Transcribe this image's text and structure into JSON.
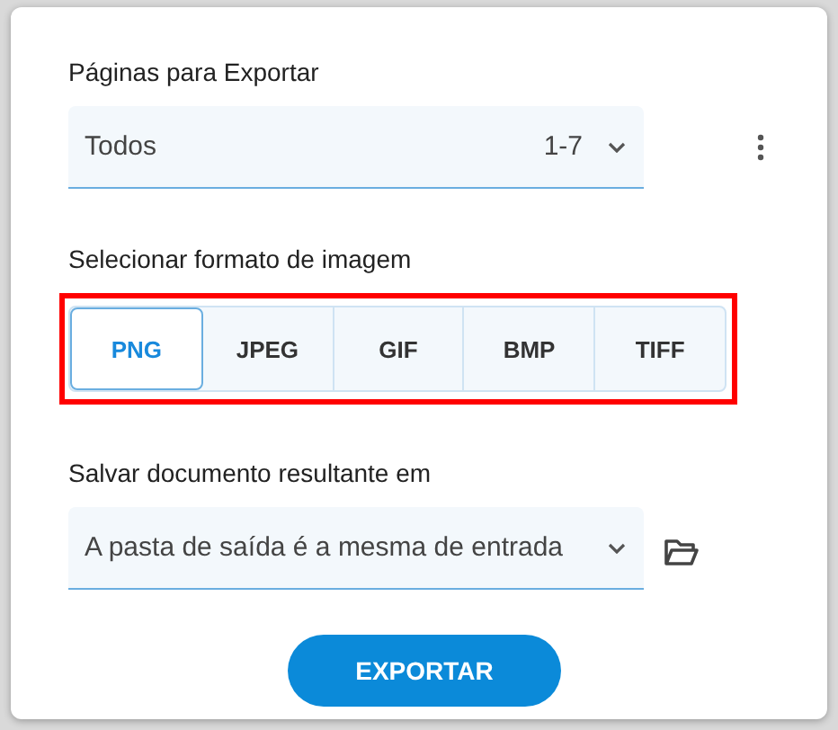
{
  "pages": {
    "label": "Páginas para Exportar",
    "value": "Todos",
    "range": "1-7"
  },
  "format": {
    "label": "Selecionar formato de imagem",
    "highlighted": true,
    "options": [
      {
        "label": "PNG",
        "selected": true
      },
      {
        "label": "JPEG",
        "selected": false
      },
      {
        "label": "GIF",
        "selected": false
      },
      {
        "label": "BMP",
        "selected": false
      },
      {
        "label": "TIFF",
        "selected": false
      }
    ]
  },
  "output": {
    "label": "Salvar documento resultante em",
    "value": "A pasta de saída é a mesma de entrada"
  },
  "button": "EXPORTAR"
}
